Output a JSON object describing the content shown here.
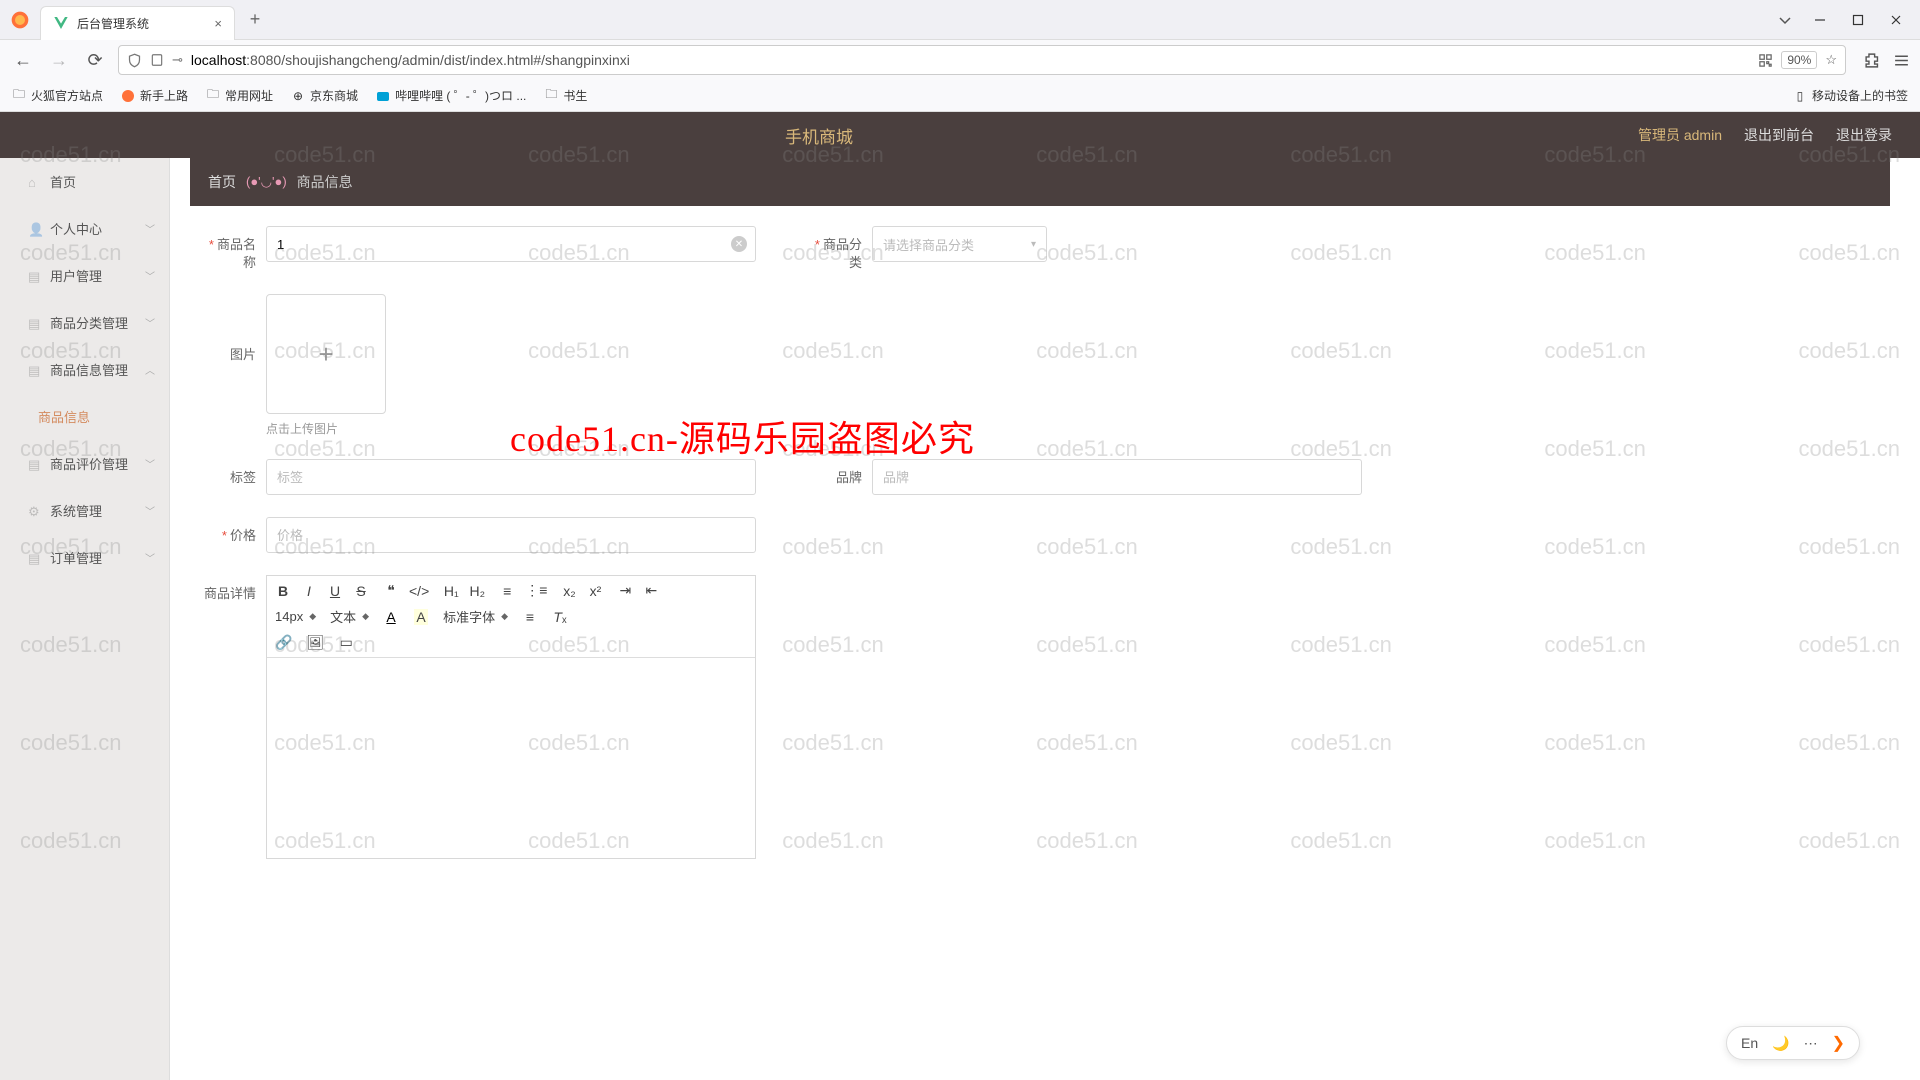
{
  "browser": {
    "tab_title": "后台管理系统",
    "url_host": "localhost",
    "url_port": ":8080",
    "url_path": "/shoujishangcheng/admin/dist/index.html#/shangpinxinxi",
    "zoom": "90%"
  },
  "bookmarks": {
    "items": [
      "火狐官方站点",
      "新手上路",
      "常用网址",
      "京东商城",
      "哔哩哔哩 ( ゜- ゜)つロ ...",
      "书生"
    ],
    "mobile": "移动设备上的书签"
  },
  "header": {
    "title": "手机商城",
    "admin": "管理员 admin",
    "to_front": "退出到前台",
    "logout": "退出登录"
  },
  "sidebar": {
    "items": [
      {
        "label": "首页"
      },
      {
        "label": "个人中心"
      },
      {
        "label": "用户管理"
      },
      {
        "label": "商品分类管理"
      },
      {
        "label": "商品信息管理"
      },
      {
        "label": "商品信息",
        "sub": true,
        "active": true
      },
      {
        "label": "商品评价管理"
      },
      {
        "label": "系统管理"
      },
      {
        "label": "订单管理"
      }
    ]
  },
  "breadcrumb": {
    "home": "首页",
    "emoji": "(●'◡'●)",
    "current": "商品信息"
  },
  "form": {
    "name_label": "商品名称",
    "name_value": "1",
    "category_label": "商品分类",
    "category_placeholder": "请选择商品分类",
    "image_label": "图片",
    "image_hint": "点击上传图片",
    "tag_label": "标签",
    "tag_placeholder": "标签",
    "brand_label": "品牌",
    "brand_placeholder": "品牌",
    "price_label": "价格",
    "price_placeholder": "价格",
    "detail_label": "商品详情"
  },
  "editor": {
    "size": "14px",
    "heading": "文本",
    "font": "标准字体"
  },
  "watermark": {
    "text": "code51.cn",
    "big": "code51.cn-源码乐园盗图必究"
  },
  "ime": {
    "lang": "En"
  }
}
